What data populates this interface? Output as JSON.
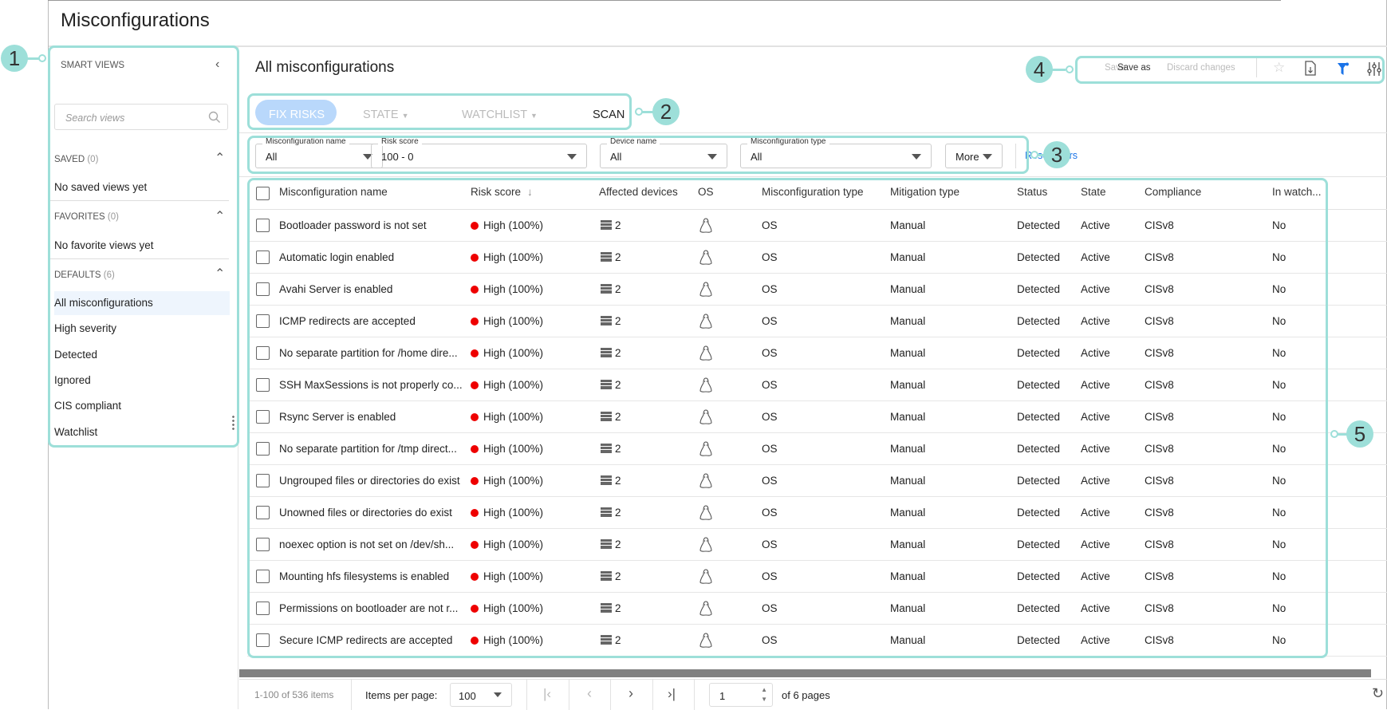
{
  "page": {
    "title": "Misconfigurations"
  },
  "sidebar": {
    "header": "SMART VIEWS",
    "search_placeholder": "Search views",
    "saved": {
      "label": "SAVED",
      "count": "(0)",
      "empty": "No saved views yet"
    },
    "favorites": {
      "label": "FAVORITES",
      "count": "(0)",
      "empty": "No favorite views yet"
    },
    "defaults": {
      "label": "DEFAULTS",
      "count": "(6)",
      "items": [
        "All misconfigurations",
        "High severity",
        "Detected",
        "Ignored",
        "CIS compliant",
        "Watchlist"
      ],
      "selected": "All misconfigurations"
    }
  },
  "main": {
    "heading": "All misconfigurations",
    "toolbar": {
      "save": "Save",
      "save_as": "Save as",
      "discard": "Discard changes",
      "icons": [
        "star-icon",
        "export-icon",
        "filter-icon",
        "column-settings-icon"
      ]
    },
    "tabs": [
      {
        "label": "FIX RISKS",
        "active": true
      },
      {
        "label": "STATE",
        "dropdown": true
      },
      {
        "label": "WATCHLIST",
        "dropdown": true
      },
      {
        "label": "SCAN"
      }
    ],
    "filters": [
      {
        "label": "Misconfiguration name",
        "value": "All"
      },
      {
        "label": "Risk score",
        "value": "100 - 0"
      },
      {
        "label": "Device name",
        "value": "All"
      },
      {
        "label": "Misconfiguration type",
        "value": "All"
      }
    ],
    "more": "More",
    "reset": "Reset filters"
  },
  "table": {
    "columns": [
      "Misconfiguration name",
      "Risk score",
      "Affected devices",
      "OS",
      "Misconfiguration type",
      "Mitigation type",
      "Status",
      "State",
      "Compliance",
      "In watch..."
    ],
    "sort_indicator": "↓",
    "rows": [
      [
        "Bootloader password is not set",
        "High (100%)",
        "2",
        "linux",
        "OS",
        "Manual",
        "Detected",
        "Active",
        "CISv8",
        "No"
      ],
      [
        "Automatic login enabled",
        "High (100%)",
        "2",
        "linux",
        "OS",
        "Manual",
        "Detected",
        "Active",
        "CISv8",
        "No"
      ],
      [
        "Avahi Server is enabled",
        "High (100%)",
        "2",
        "linux",
        "OS",
        "Manual",
        "Detected",
        "Active",
        "CISv8",
        "No"
      ],
      [
        "ICMP redirects are accepted",
        "High (100%)",
        "2",
        "linux",
        "OS",
        "Manual",
        "Detected",
        "Active",
        "CISv8",
        "No"
      ],
      [
        "No separate partition for /home dire...",
        "High (100%)",
        "2",
        "linux",
        "OS",
        "Manual",
        "Detected",
        "Active",
        "CISv8",
        "No"
      ],
      [
        "SSH MaxSessions is not properly co...",
        "High (100%)",
        "2",
        "linux",
        "OS",
        "Manual",
        "Detected",
        "Active",
        "CISv8",
        "No"
      ],
      [
        "Rsync Server is enabled",
        "High (100%)",
        "2",
        "linux",
        "OS",
        "Manual",
        "Detected",
        "Active",
        "CISv8",
        "No"
      ],
      [
        "No separate partition for /tmp direct...",
        "High (100%)",
        "2",
        "linux",
        "OS",
        "Manual",
        "Detected",
        "Active",
        "CISv8",
        "No"
      ],
      [
        "Ungrouped files or directories do exist",
        "High (100%)",
        "2",
        "linux",
        "OS",
        "Manual",
        "Detected",
        "Active",
        "CISv8",
        "No"
      ],
      [
        "Unowned files or directories do exist",
        "High (100%)",
        "2",
        "linux",
        "OS",
        "Manual",
        "Detected",
        "Active",
        "CISv8",
        "No"
      ],
      [
        "noexec option is not set on /dev/sh...",
        "High (100%)",
        "2",
        "linux",
        "OS",
        "Manual",
        "Detected",
        "Active",
        "CISv8",
        "No"
      ],
      [
        "Mounting hfs filesystems is enabled",
        "High (100%)",
        "2",
        "linux",
        "OS",
        "Manual",
        "Detected",
        "Active",
        "CISv8",
        "No"
      ],
      [
        "Permissions on bootloader are not r...",
        "High (100%)",
        "2",
        "linux",
        "OS",
        "Manual",
        "Detected",
        "Active",
        "CISv8",
        "No"
      ],
      [
        "Secure ICMP redirects are accepted",
        "High (100%)",
        "2",
        "linux",
        "OS",
        "Manual",
        "Detected",
        "Active",
        "CISv8",
        "No"
      ]
    ]
  },
  "footer": {
    "range": "1-100 of 536 items",
    "per_page_label": "Items per page:",
    "per_page": "100",
    "page": "1",
    "of_pages": "of 6 pages"
  },
  "callouts": [
    "1",
    "2",
    "3",
    "4",
    "5"
  ],
  "colors": {
    "accent": "#1a73e8",
    "callout": "#9ddfd9",
    "tab_active_bg": "#b9d8fb",
    "risk_high": "#e00000"
  }
}
